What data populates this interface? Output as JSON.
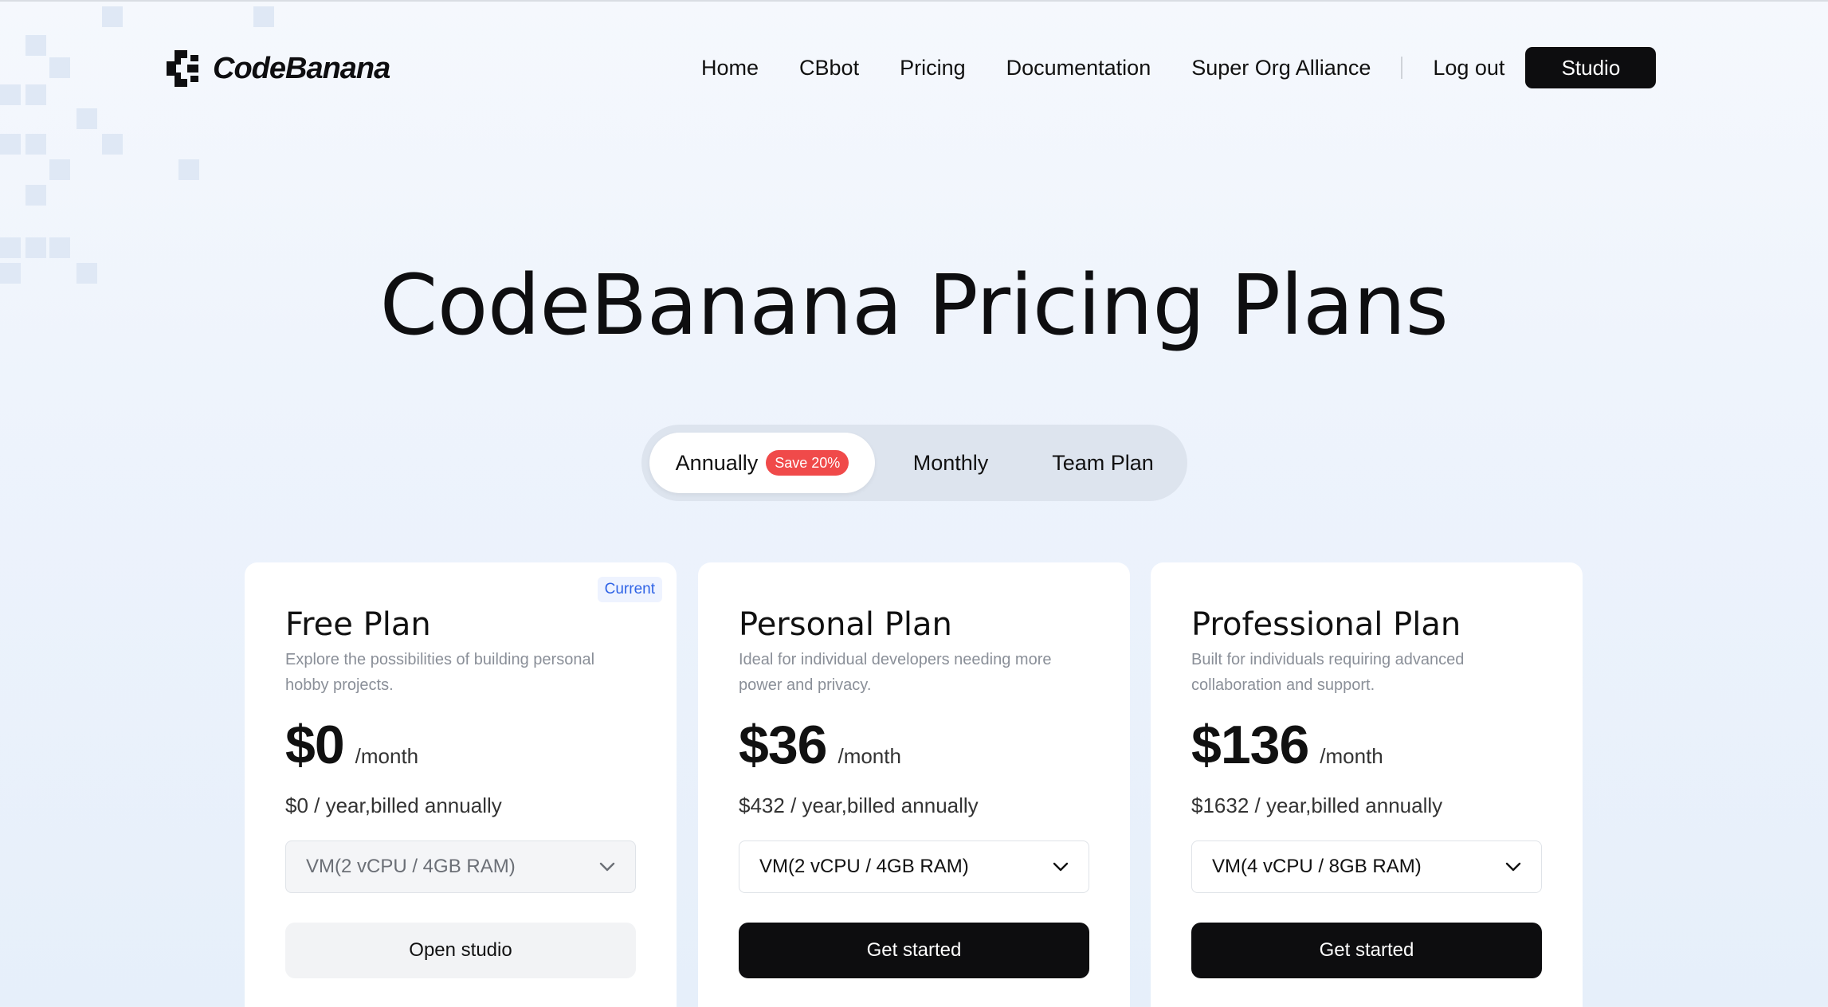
{
  "brand": {
    "name": "CodeBanana"
  },
  "nav": {
    "items": [
      "Home",
      "CBbot",
      "Pricing",
      "Documentation",
      "Super Org Alliance"
    ],
    "logout": "Log out",
    "studio": "Studio"
  },
  "title": "CodeBanana Pricing Plans",
  "billing": {
    "annually": "Annually",
    "save_badge": "Save 20%",
    "monthly": "Monthly",
    "team": "Team Plan"
  },
  "plans": [
    {
      "name": "Free Plan",
      "tag": "Current",
      "description": "Explore the possibilities of building personal hobby projects.",
      "price": "$0",
      "per": "/month",
      "billed": "$0 / year,billed annually",
      "vm": "VM(2 vCPU / 4GB RAM)",
      "cta": "Open studio"
    },
    {
      "name": "Personal Plan",
      "description": "Ideal for individual developers needing more power and privacy.",
      "price": "$36",
      "per": "/month",
      "billed": "$432 / year,billed annually",
      "vm": "VM(2 vCPU / 4GB RAM)",
      "cta": "Get started"
    },
    {
      "name": "Professional Plan",
      "description": "Built for individuals requiring advanced collaboration and support.",
      "price": "$136",
      "per": "/month",
      "billed": "$1632 / year,billed annually",
      "vm": "VM(4 vCPU / 8GB RAM)",
      "cta": "Get started"
    }
  ],
  "colors": {
    "accent_dark": "#0d0d0f",
    "badge_red": "#f04a4a",
    "current_blue": "#2f63e6",
    "toggle_bg": "#dde4ee"
  },
  "icons": {
    "logo": "codebanana-logo-icon",
    "dropdown": "chevron-down-icon"
  }
}
